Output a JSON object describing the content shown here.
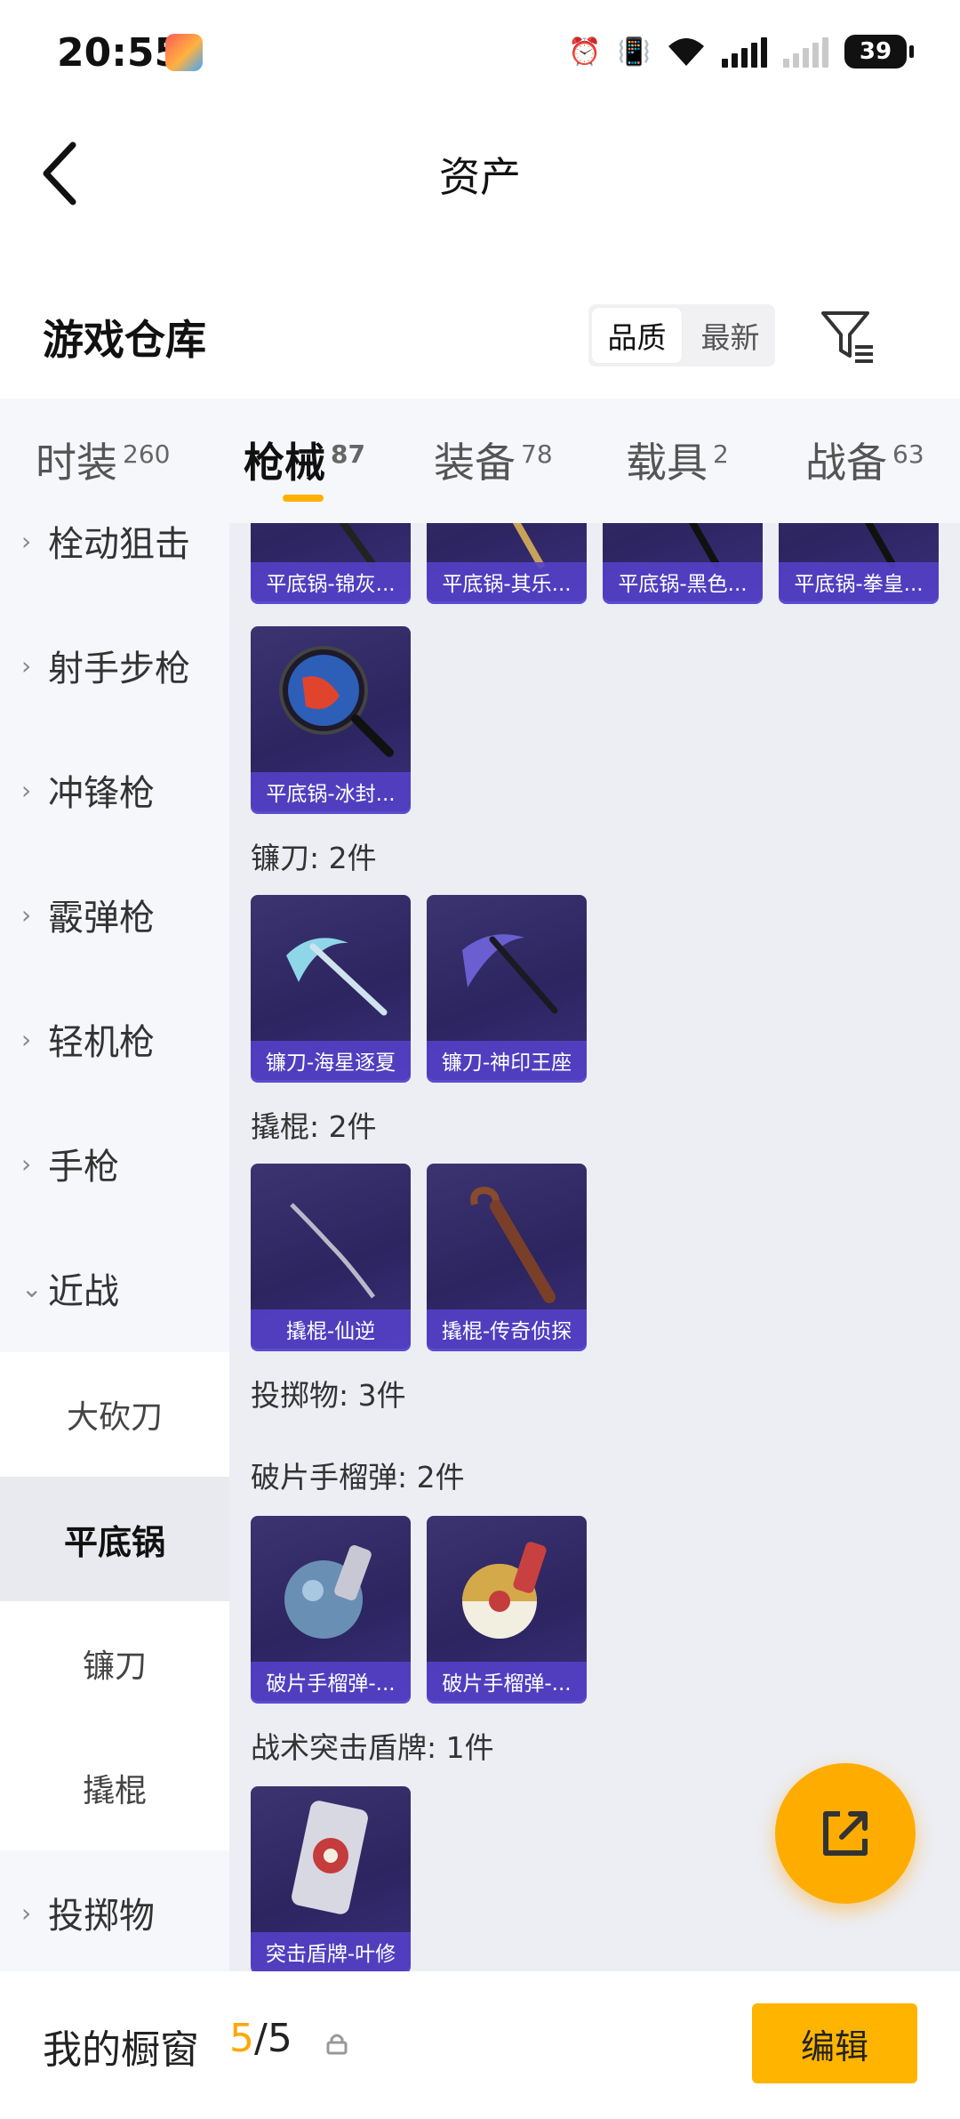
{
  "status_bar": {
    "time": "20:55",
    "battery": "39"
  },
  "header": {
    "title": "资产"
  },
  "warehouse": {
    "title": "游戏仓库",
    "sort_quality": "品质",
    "sort_newest": "最新"
  },
  "tabs": [
    {
      "label": "时装",
      "count": "260"
    },
    {
      "label": "枪械",
      "count": "87"
    },
    {
      "label": "装备",
      "count": "78"
    },
    {
      "label": "载具",
      "count": "2"
    },
    {
      "label": "战备",
      "count": "63"
    }
  ],
  "sidebar": {
    "categories": [
      "栓动狙击",
      "射手步枪",
      "冲锋枪",
      "霰弹枪",
      "轻机枪",
      "手枪",
      "近战"
    ],
    "subcategories": [
      "大砍刀",
      "平底锅",
      "镰刀",
      "撬棍"
    ],
    "last_category": "投掷物"
  },
  "content": {
    "pan_row": [
      "平底锅-锦灰...",
      "平底锅-其乐...",
      "平底锅-黑色...",
      "平底锅-拳皇..."
    ],
    "pan_extra": "平底锅-冰封...",
    "sickle_header": "镰刀: 2件",
    "sickle_items": [
      "镰刀-海星逐夏",
      "镰刀-神印王座"
    ],
    "crowbar_header": "撬棍: 2件",
    "crowbar_items": [
      "撬棍-仙逆",
      "撬棍-传奇侦探"
    ],
    "throwable_header": "投掷物: 3件",
    "frag_header": "破片手榴弹: 2件",
    "frag_items": [
      "破片手榴弹-...",
      "破片手榴弹-..."
    ],
    "shield_header": "战术突击盾牌: 1件",
    "shield_items": [
      "突击盾牌-叶修"
    ]
  },
  "bottom_bar": {
    "label": "我的橱窗",
    "used": "5",
    "total": "/5",
    "edit": "编辑"
  },
  "colors": {
    "accent": "#ffb000",
    "card_bg": "#2c2560",
    "card_label": "#5440c8"
  }
}
